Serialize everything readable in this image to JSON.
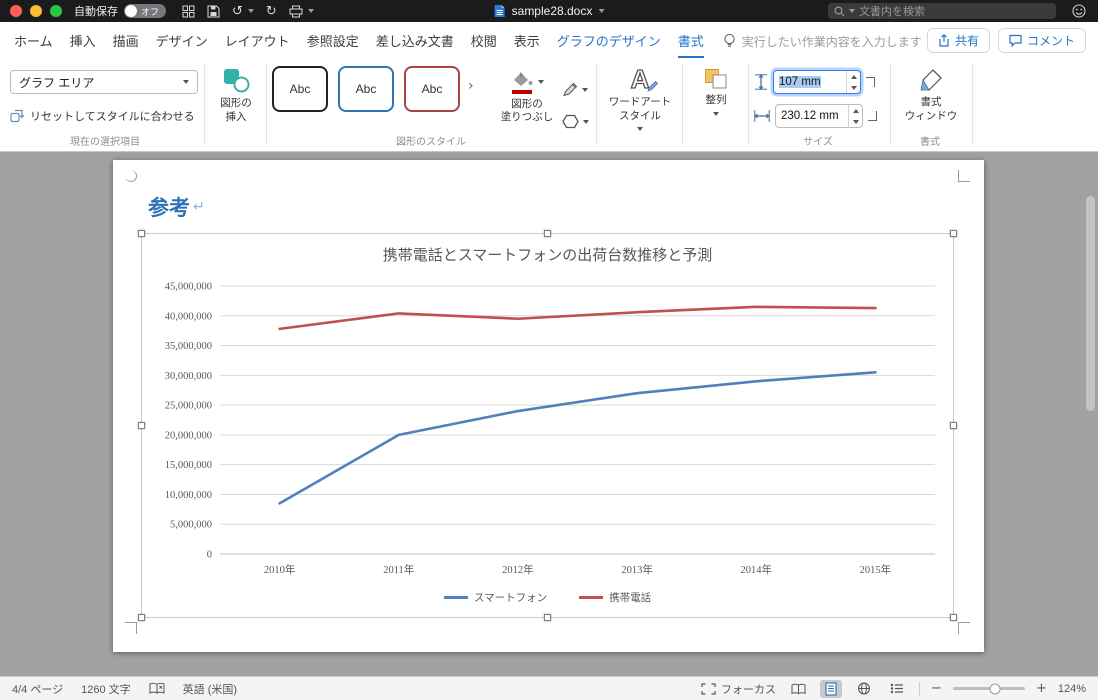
{
  "titlebar": {
    "autosave_label": "自動保存",
    "autosave_state": "オフ",
    "doc_title": "sample28.docx",
    "search_placeholder": "文書内を検索",
    "undo_glyph": "↺",
    "redo_glyph": "↻"
  },
  "ribbon": {
    "tabs": [
      {
        "label": "ホーム",
        "contextual": false
      },
      {
        "label": "挿入",
        "contextual": false
      },
      {
        "label": "描画",
        "contextual": false
      },
      {
        "label": "デザイン",
        "contextual": false
      },
      {
        "label": "レイアウト",
        "contextual": false
      },
      {
        "label": "参照設定",
        "contextual": false
      },
      {
        "label": "差し込み文書",
        "contextual": false
      },
      {
        "label": "校閲",
        "contextual": false
      },
      {
        "label": "表示",
        "contextual": false
      },
      {
        "label": "グラフのデザイン",
        "contextual": true
      },
      {
        "label": "書式",
        "contextual": true
      }
    ],
    "active_tab": "書式",
    "tell_me": "実行したい作業内容を入力します",
    "share_label": "共有",
    "comments_label": "コメント"
  },
  "format_ribbon": {
    "selection_combo_value": "グラフ エリア",
    "reset_style_label": "リセットしてスタイルに合わせる",
    "selection_group_label": "現在の選択項目",
    "insert_shape_lines": [
      "図形の",
      "挿入"
    ],
    "style_gallery": [
      {
        "label": "Abc",
        "border": "#222222"
      },
      {
        "label": "Abc",
        "border": "#2e75b6"
      },
      {
        "label": "Abc",
        "border": "#a94442"
      }
    ],
    "gallery_more_glyph": "›",
    "shape_styles_group_label": "図形のスタイル",
    "shape_fill_lines": [
      "図形の",
      "塗りつぶし"
    ],
    "wordart_lines": [
      "ワードアート",
      "スタイル"
    ],
    "arrange_label": "整列",
    "height_value": "107 mm",
    "width_value": "230.12 mm",
    "size_group_label": "サイズ",
    "format_pane_lines": [
      "書式",
      "ウィンドウ"
    ],
    "format_group_label": "書式"
  },
  "document": {
    "heading": "参考",
    "pilcrow_glyph": "↵"
  },
  "chart_data": {
    "type": "line",
    "title": "携帯電話とスマートフォンの出荷台数推移と予測",
    "categories": [
      "2010年",
      "2011年",
      "2012年",
      "2013年",
      "2014年",
      "2015年"
    ],
    "series": [
      {
        "name": "スマートフォン",
        "color": "#4f81bd",
        "values": [
          8500000,
          20000000,
          24000000,
          27000000,
          29000000,
          30500000
        ]
      },
      {
        "name": "携帯電話",
        "color": "#c0504d",
        "values": [
          37800000,
          40400000,
          39500000,
          40600000,
          41500000,
          41300000
        ]
      }
    ],
    "xlabel": "",
    "ylabel": "",
    "ylim": [
      0,
      45000000
    ],
    "ytick_step": 5000000,
    "grid": true,
    "legend_position": "bottom"
  },
  "statusbar": {
    "page_label": "4/4 ページ",
    "word_count": "1260 文字",
    "language": "英語 (米国)",
    "focus_label": "フォーカス",
    "zoom_out_glyph": "−",
    "zoom_in_glyph": "+",
    "zoom_level": "124%"
  }
}
